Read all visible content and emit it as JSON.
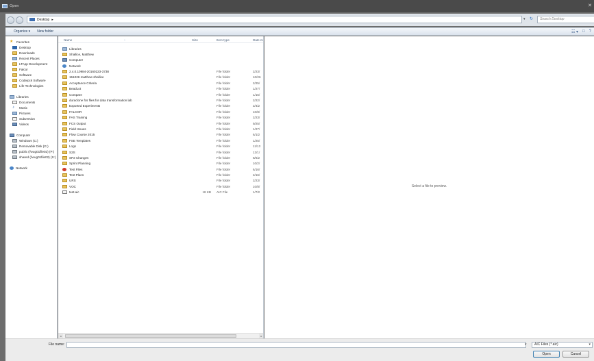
{
  "window": {
    "title": "Open"
  },
  "address": {
    "breadcrumb": "Desktop",
    "breadcrumb_arrow": "▸",
    "dropdown": "▾",
    "refresh": "↻",
    "search_placeholder": "Search Desktop",
    "search_icon": "⌕"
  },
  "toolbar": {
    "organize": "Organize ▾",
    "new_folder": "New folder",
    "view_icon": "☷ ▾",
    "pane_icon": "□",
    "help_icon": "?"
  },
  "nav": {
    "favorites": [
      {
        "label": "Favorites",
        "icon": "star-icon"
      },
      {
        "label": "Desktop",
        "icon": "desktop-icon"
      },
      {
        "label": "Downloads",
        "icon": "downloads-icon"
      },
      {
        "label": "Recent Places",
        "icon": "recent-places-icon"
      },
      {
        "label": "LTApp Development",
        "icon": "folder-icon"
      },
      {
        "label": "Falcor",
        "icon": "folder-icon"
      },
      {
        "label": "Software",
        "icon": "folder-icon"
      },
      {
        "label": "Codejock Software",
        "icon": "folder-icon"
      },
      {
        "label": "Life Technologies",
        "icon": "folder-icon"
      }
    ],
    "libraries": [
      {
        "label": "Libraries"
      },
      {
        "label": "Documents"
      },
      {
        "label": "Music"
      },
      {
        "label": "Pictures"
      },
      {
        "label": "Subversion"
      },
      {
        "label": "Videos"
      }
    ],
    "computer": [
      {
        "label": "Computer"
      },
      {
        "label": "Windows (C:)"
      },
      {
        "label": "Removable Disk (G:)"
      },
      {
        "label": "public (\\\\eug01file02) (P:)"
      },
      {
        "label": "shared (\\\\eug01file02) (S:)"
      }
    ],
    "network": {
      "label": "Network"
    }
  },
  "columns": {
    "name": "Name",
    "size": "Size",
    "type": "Item type",
    "date": "Date modified",
    "sort_caret": "^"
  },
  "files": [
    {
      "name": "Libraries",
      "size": "",
      "type": "",
      "date": "",
      "icon": "lib"
    },
    {
      "name": "Shallice, Matthew",
      "size": "",
      "type": "",
      "date": "",
      "icon": "folder"
    },
    {
      "name": "Computer",
      "size": "",
      "type": "",
      "date": "",
      "icon": "pc"
    },
    {
      "name": "Network",
      "size": "",
      "type": "",
      "date": "",
      "icon": "net"
    },
    {
      "name": "2.4.0.10984-20160223-3738",
      "size": "",
      "type": "File folder",
      "date": "2/23/",
      "icon": "folder"
    },
    {
      "name": "151026 matthew shallice",
      "size": "",
      "type": "File folder",
      "date": "10/26",
      "icon": "folder"
    },
    {
      "name": "Acceptance Criteria",
      "size": "",
      "type": "File folder",
      "date": "2/25/",
      "icon": "folder"
    },
    {
      "name": "BeadLot",
      "size": "",
      "type": "File folder",
      "date": "1/27/",
      "icon": "folder"
    },
    {
      "name": "Compare",
      "size": "",
      "type": "File folder",
      "date": "1/15/",
      "icon": "folder"
    },
    {
      "name": "duraclone fcs files for data transformation lab",
      "size": "",
      "type": "File folder",
      "date": "2/22/",
      "icon": "folder"
    },
    {
      "name": "Exported Experiments",
      "size": "",
      "type": "File folder",
      "date": "2/4/2",
      "icon": "folder"
    },
    {
      "name": "FALCOR",
      "size": "",
      "type": "File folder",
      "date": "10/8/",
      "icon": "folder"
    },
    {
      "name": "FAS Training",
      "size": "",
      "type": "File folder",
      "date": "2/23/",
      "icon": "folder"
    },
    {
      "name": "FCS Output",
      "size": "",
      "type": "File folder",
      "date": "9/25/",
      "icon": "folder"
    },
    {
      "name": "Field Issues",
      "size": "",
      "type": "File folder",
      "date": "1/27/",
      "icon": "folder"
    },
    {
      "name": "Flow Course 2015",
      "size": "",
      "type": "File folder",
      "date": "6/1/2",
      "icon": "folder"
    },
    {
      "name": "FSE Templates",
      "size": "",
      "type": "File folder",
      "date": "1/25/",
      "icon": "folder"
    },
    {
      "name": "Logs",
      "size": "",
      "type": "File folder",
      "date": "11/13",
      "icon": "folder"
    },
    {
      "name": "S2S",
      "size": "",
      "type": "File folder",
      "date": "12/1/",
      "icon": "folder"
    },
    {
      "name": "SP2 Changes",
      "size": "",
      "type": "File folder",
      "date": "8/6/2",
      "icon": "folder"
    },
    {
      "name": "Sprint Planning",
      "size": "",
      "type": "File folder",
      "date": "10/2/",
      "icon": "folder"
    },
    {
      "name": "Test Files",
      "size": "",
      "type": "File folder",
      "date": "6/16/",
      "icon": "red"
    },
    {
      "name": "Test Plans",
      "size": "",
      "type": "File folder",
      "date": "2/16/",
      "icon": "folder"
    },
    {
      "name": "URS",
      "size": "",
      "type": "File folder",
      "date": "2/23/",
      "icon": "folder"
    },
    {
      "name": "VOC",
      "size": "",
      "type": "File folder",
      "date": "10/8/",
      "icon": "folder"
    },
    {
      "name": "test.aic",
      "size": "18 KB",
      "type": "AIC File",
      "date": "1/7/2",
      "icon": "doc"
    }
  ],
  "preview": {
    "message": "Select a file to preview."
  },
  "bottom": {
    "file_name_label": "File name:",
    "file_name_value": "",
    "dropdown": "▾",
    "filter": "AIC Files (*.aic)",
    "open": "Open",
    "cancel": "Cancel"
  },
  "scroll": {
    "left": "◂",
    "right": "▸"
  }
}
